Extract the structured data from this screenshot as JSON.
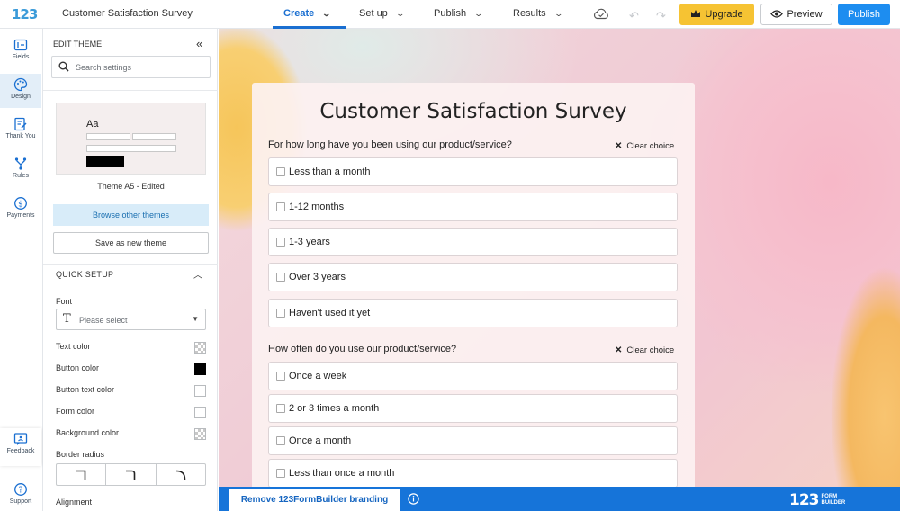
{
  "app": {
    "logo": "123",
    "form_title": "Customer Satisfaction Survey",
    "brand_color": "#1d8df0"
  },
  "topbar": {
    "tabs": [
      {
        "label": "Create",
        "active": true
      },
      {
        "label": "Set up",
        "active": false
      },
      {
        "label": "Publish",
        "active": false
      },
      {
        "label": "Results",
        "active": false
      }
    ],
    "upgrade_label": "Upgrade",
    "preview_label": "Preview",
    "publish_label": "Publish"
  },
  "rail": {
    "items": [
      {
        "label": "Fields",
        "icon": "fields-icon",
        "active": false
      },
      {
        "label": "Design",
        "icon": "palette-icon",
        "active": true
      },
      {
        "label": "Thank You",
        "icon": "thank-you-icon",
        "active": false
      },
      {
        "label": "Rules",
        "icon": "rules-icon",
        "active": false
      },
      {
        "label": "Payments",
        "icon": "payments-icon",
        "active": false
      }
    ],
    "feedback_label": "Feedback",
    "support_label": "Support"
  },
  "panel": {
    "title": "EDIT THEME",
    "search_placeholder": "Search settings",
    "theme_preview_text": "Aa",
    "theme_name": "Theme A5 - Edited",
    "browse_label": "Browse other themes",
    "save_label": "Save as new theme",
    "quick_setup_label": "QUICK SETUP",
    "font_label": "Font",
    "font_placeholder": "Please select",
    "colors": [
      {
        "label": "Text color",
        "swatch": "checker"
      },
      {
        "label": "Button color",
        "swatch": "#000000"
      },
      {
        "label": "Button text color",
        "swatch": "#ffffff"
      },
      {
        "label": "Form color",
        "swatch": "#ffffff"
      },
      {
        "label": "Background color",
        "swatch": "checker"
      }
    ],
    "border_radius_label": "Border radius",
    "alignment_label": "Alignment"
  },
  "form": {
    "heading": "Customer Satisfaction Survey",
    "clear_choice_label": "Clear choice",
    "questions": [
      {
        "title": "For how long have you been using our product/service?",
        "options": [
          "Less than a month",
          "1-12 months",
          "1-3 years",
          "Over 3 years",
          "Haven't used it yet"
        ]
      },
      {
        "title": "How often do you use our product/service?",
        "options": [
          "Once a week",
          "2 or 3 times a month",
          "Once a month",
          "Less than once a month"
        ]
      }
    ]
  },
  "bottombar": {
    "remove_branding_label": "Remove 123FormBuilder branding",
    "brand_logo_number": "123",
    "brand_logo_line1": "FORM",
    "brand_logo_line2": "BUILDER"
  }
}
